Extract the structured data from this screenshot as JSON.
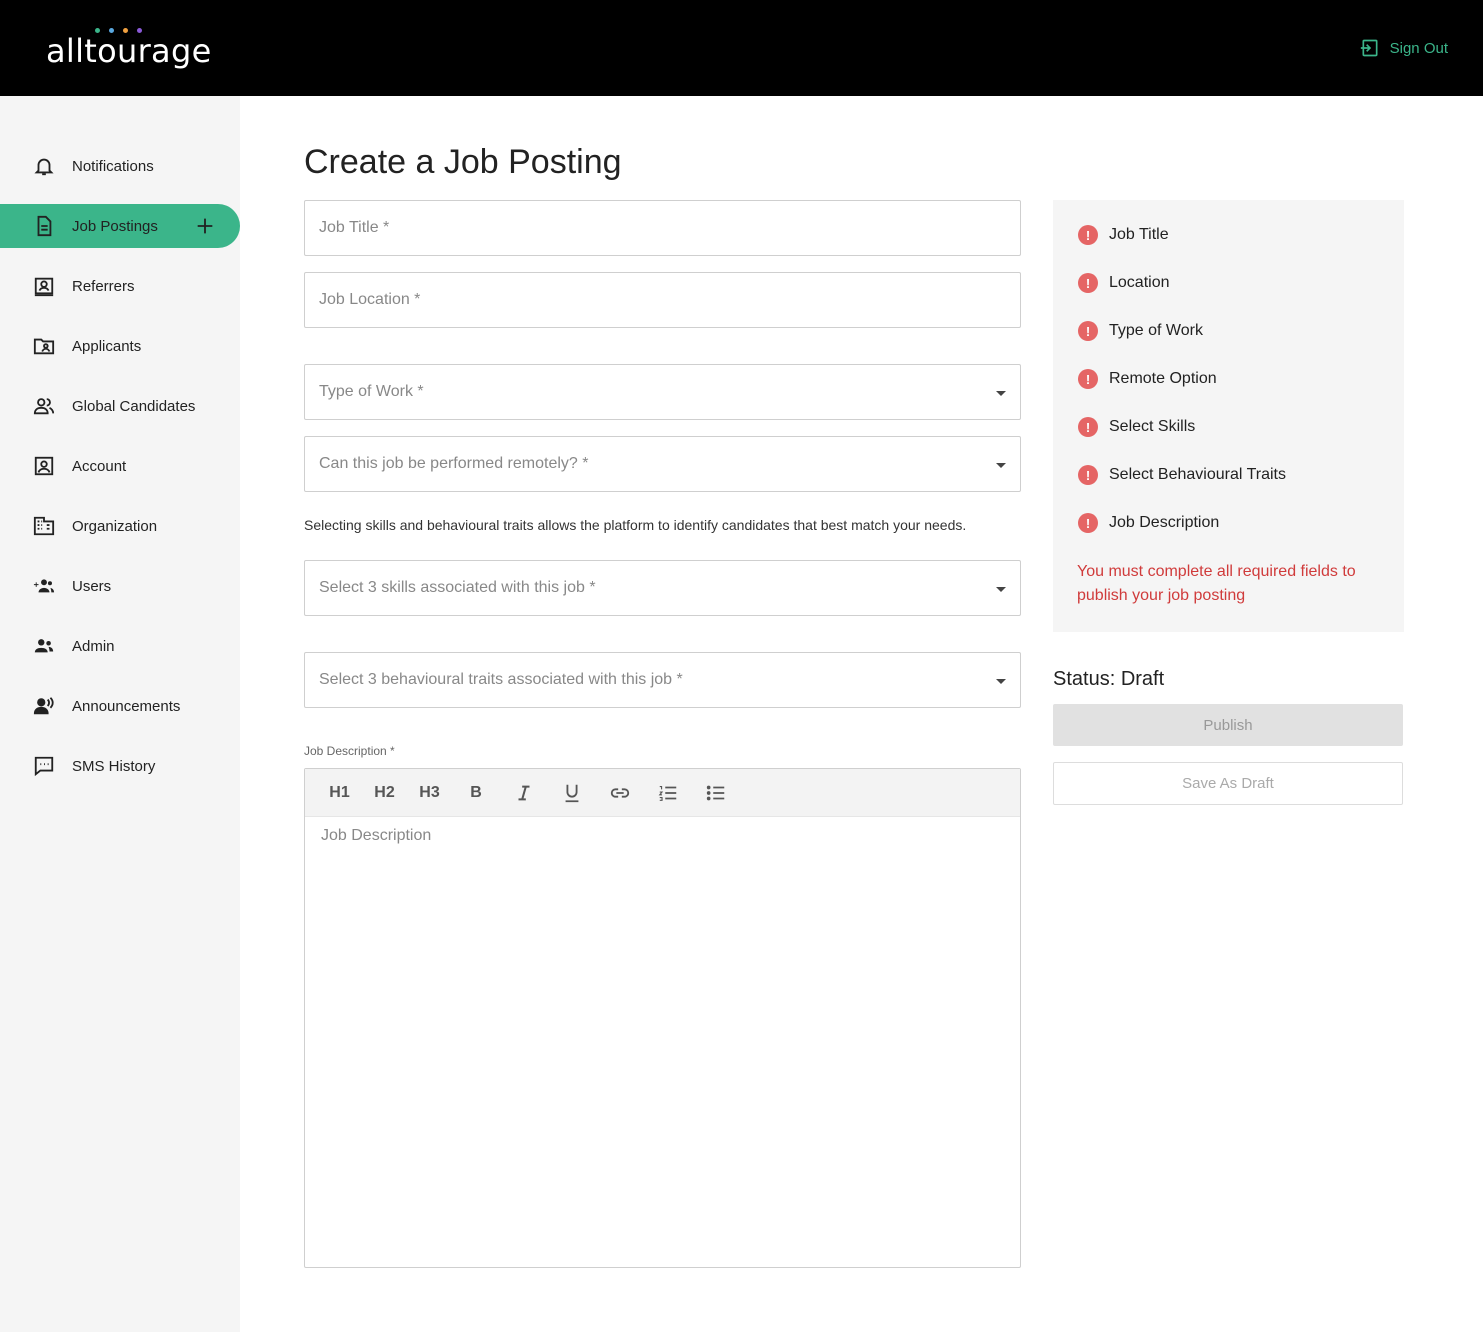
{
  "colors": {
    "accent": "#3bb58a",
    "header_bg": "#000000",
    "sidebar_bg": "#f5f5f5",
    "error": "#e56565",
    "error_text": "#d03b3b",
    "logo_dots": [
      "#3bb58a",
      "#5aa8e0",
      "#f0a040",
      "#8a5ad8"
    ]
  },
  "header": {
    "logo": "alltourage",
    "sign_out": "Sign Out"
  },
  "sidebar": {
    "items": [
      {
        "label": "Notifications",
        "icon": "bell-icon"
      },
      {
        "label": "Job Postings",
        "icon": "document-icon",
        "active": true
      },
      {
        "label": "Referrers",
        "icon": "contact-card-icon"
      },
      {
        "label": "Applicants",
        "icon": "folder-user-icon"
      },
      {
        "label": "Global Candidates",
        "icon": "people-icon"
      },
      {
        "label": "Account",
        "icon": "account-box-icon"
      },
      {
        "label": "Organization",
        "icon": "building-icon"
      },
      {
        "label": "Users",
        "icon": "add-group-icon"
      },
      {
        "label": "Admin",
        "icon": "admin-people-icon"
      },
      {
        "label": "Announcements",
        "icon": "speaker-person-icon"
      },
      {
        "label": "SMS History",
        "icon": "chat-bubble-icon"
      }
    ]
  },
  "main": {
    "title": "Create a Job Posting",
    "job_title_placeholder": "Job Title *",
    "job_location_placeholder": "Job Location *",
    "type_of_work_placeholder": "Type of Work *",
    "remote_placeholder": "Can this job be performed remotely? *",
    "helper_text": "Selecting skills and behavioural traits allows the platform to identify candidates that best match your needs.",
    "skills_placeholder": "Select 3 skills associated with this job *",
    "traits_placeholder": "Select 3 behavioural traits associated with this job *",
    "description_label": "Job Description *",
    "description_placeholder": "Job Description",
    "toolbar": {
      "h1": "H1",
      "h2": "H2",
      "h3": "H3",
      "bold": "B"
    }
  },
  "checklist": {
    "items": [
      "Job Title",
      "Location",
      "Type of Work",
      "Remote Option",
      "Select Skills",
      "Select Behavioural Traits",
      "Job Description"
    ],
    "alert_glyph": "!",
    "message": "You must complete all required fields to publish your job posting"
  },
  "status": {
    "label": "Status: Draft",
    "publish": "Publish",
    "save_draft": "Save As Draft"
  }
}
